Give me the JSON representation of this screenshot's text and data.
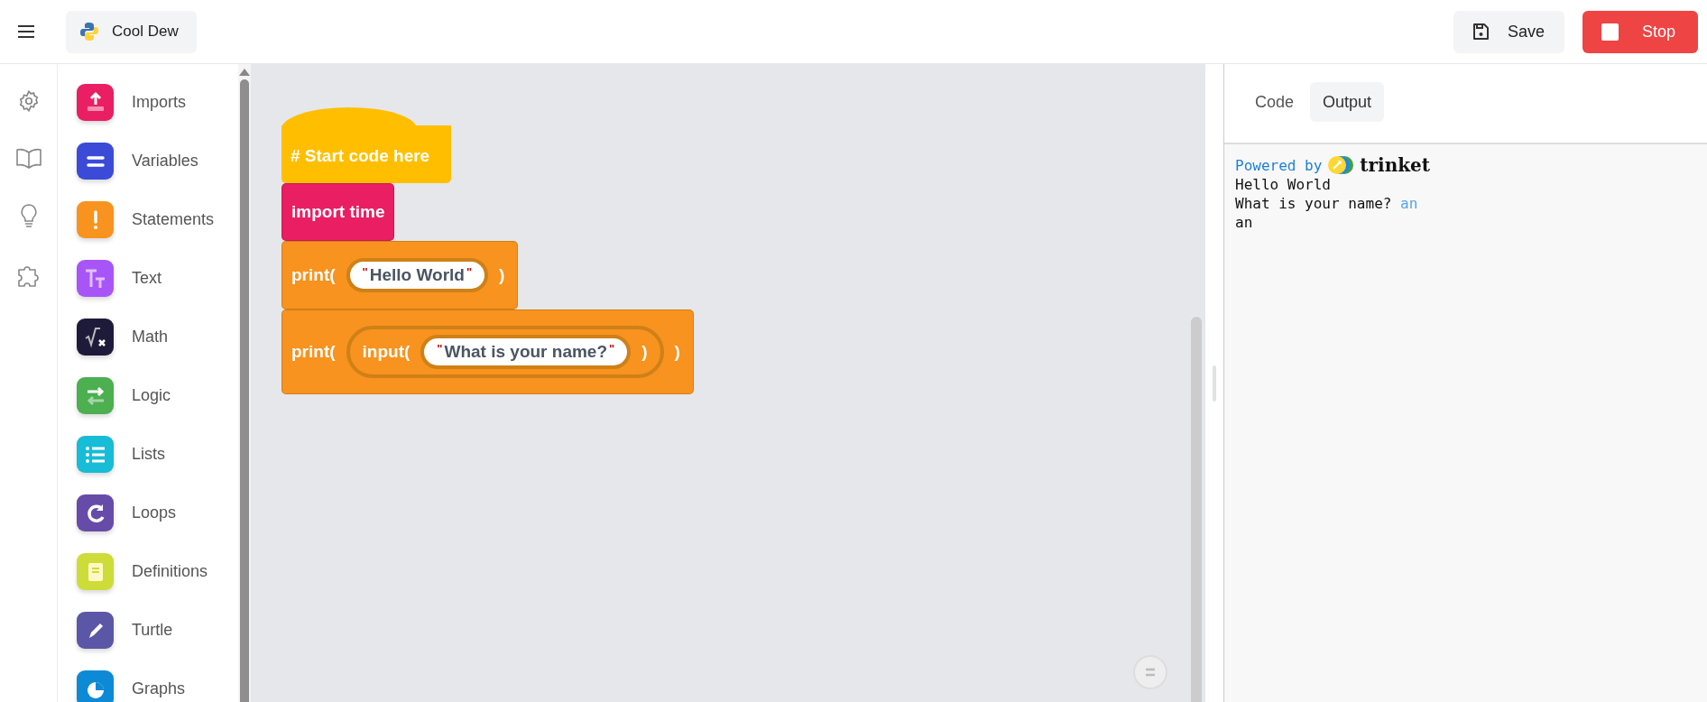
{
  "header": {
    "project": "Cool Dew",
    "save": "Save",
    "stop": "Stop"
  },
  "categories": [
    {
      "label": "Imports",
      "color": "#e91e63"
    },
    {
      "label": "Variables",
      "color": "#3b4bd8"
    },
    {
      "label": "Statements",
      "color": "#f7931e"
    },
    {
      "label": "Text",
      "color": "#a855f7"
    },
    {
      "label": "Math",
      "color": "#1e1b3a"
    },
    {
      "label": "Logic",
      "color": "#4caf50"
    },
    {
      "label": "Lists",
      "color": "#17bcd6"
    },
    {
      "label": "Loops",
      "color": "#674ba8"
    },
    {
      "label": "Definitions",
      "color": "#cddc39"
    },
    {
      "label": "Turtle",
      "color": "#5b57a6"
    },
    {
      "label": "Graphs",
      "color": "#0d8ad6"
    }
  ],
  "blocks": [
    {
      "kind": "hat",
      "text": "# Start code here",
      "color": "#ffbf00"
    },
    {
      "kind": "statement",
      "text": "import time",
      "color": "#e91e63"
    },
    {
      "kind": "call",
      "label": "print(",
      "close": ")",
      "color": "#f7931e",
      "args": [
        {
          "kind": "string",
          "value": "Hello World",
          "open_quote": "\"",
          "close_quote": "\""
        }
      ]
    },
    {
      "kind": "call",
      "label": "print(",
      "close": ")",
      "color": "#f7931e",
      "args": [
        {
          "kind": "call",
          "label": "input(",
          "close": ")",
          "args": [
            {
              "kind": "string",
              "value": "What is your name?",
              "open_quote": "\"",
              "close_quote": "\""
            }
          ]
        }
      ]
    }
  ],
  "tabs": [
    {
      "label": "Code",
      "selected": false
    },
    {
      "label": "Output",
      "selected": true
    }
  ],
  "console": {
    "powered_by": "Powered by",
    "brand": "trinket",
    "lines": [
      {
        "text": "Hello World"
      },
      {
        "text": "What is your name? ",
        "input": "an"
      },
      {
        "text": "an"
      }
    ]
  }
}
